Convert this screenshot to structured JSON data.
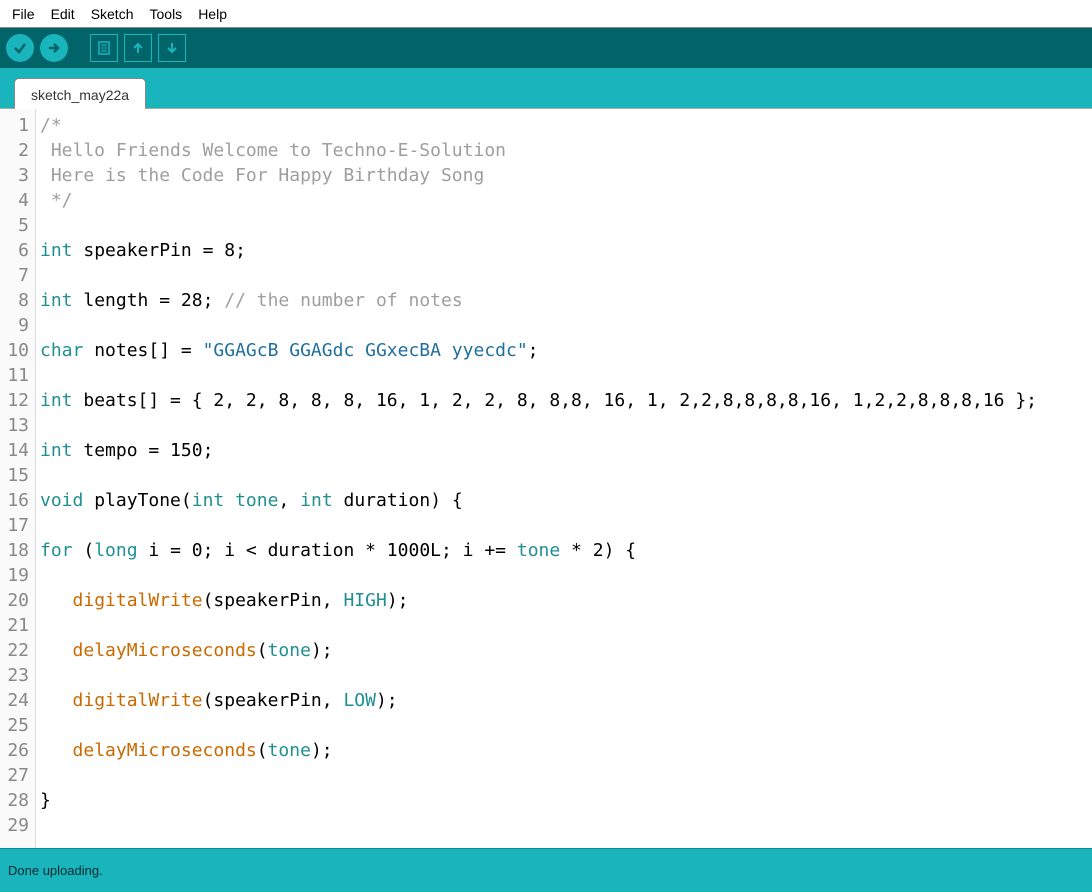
{
  "menu": {
    "items": [
      "File",
      "Edit",
      "Sketch",
      "Tools",
      "Help"
    ]
  },
  "toolbar": {
    "verify": "verify",
    "upload": "upload",
    "new": "new",
    "open": "open",
    "save": "save"
  },
  "tabs": [
    {
      "label": "sketch_may22a"
    }
  ],
  "editor": {
    "lines": [
      [
        {
          "cls": "tok-comment",
          "t": "/*"
        }
      ],
      [
        {
          "cls": "tok-comment",
          "t": " Hello Friends Welcome to Techno-E-Solution"
        }
      ],
      [
        {
          "cls": "tok-comment",
          "t": " Here is the Code For Happy Birthday Song"
        }
      ],
      [
        {
          "cls": "tok-comment",
          "t": " */"
        }
      ],
      [
        {
          "cls": "tok-plain",
          "t": ""
        }
      ],
      [
        {
          "cls": "tok-type",
          "t": "int "
        },
        {
          "cls": "tok-plain",
          "t": "speakerPin = 8;"
        }
      ],
      [
        {
          "cls": "tok-plain",
          "t": ""
        }
      ],
      [
        {
          "cls": "tok-type",
          "t": "int "
        },
        {
          "cls": "tok-plain",
          "t": "length = 28; "
        },
        {
          "cls": "tok-comment",
          "t": "// the number of notes"
        }
      ],
      [
        {
          "cls": "tok-plain",
          "t": ""
        }
      ],
      [
        {
          "cls": "tok-type",
          "t": "char "
        },
        {
          "cls": "tok-plain",
          "t": "notes[] = "
        },
        {
          "cls": "tok-string",
          "t": "\"GGAGcB GGAGdc GGxecBA yyecdc\""
        },
        {
          "cls": "tok-plain",
          "t": ";"
        }
      ],
      [
        {
          "cls": "tok-plain",
          "t": ""
        }
      ],
      [
        {
          "cls": "tok-type",
          "t": "int "
        },
        {
          "cls": "tok-plain",
          "t": "beats[] = { 2, 2, 8, 8, 8, 16, 1, 2, 2, 8, 8,8, 16, 1, 2,2,8,8,8,8,16, 1,2,2,8,8,8,16 };"
        }
      ],
      [
        {
          "cls": "tok-plain",
          "t": ""
        }
      ],
      [
        {
          "cls": "tok-type",
          "t": "int "
        },
        {
          "cls": "tok-plain",
          "t": "tempo = 150;"
        }
      ],
      [
        {
          "cls": "tok-plain",
          "t": ""
        }
      ],
      [
        {
          "cls": "tok-type",
          "t": "void "
        },
        {
          "cls": "tok-plain",
          "t": "playTone("
        },
        {
          "cls": "tok-type",
          "t": "int "
        },
        {
          "cls": "tok-const",
          "t": "tone"
        },
        {
          "cls": "tok-plain",
          "t": ", "
        },
        {
          "cls": "tok-type",
          "t": "int "
        },
        {
          "cls": "tok-plain",
          "t": "duration) {"
        }
      ],
      [
        {
          "cls": "tok-plain",
          "t": ""
        }
      ],
      [
        {
          "cls": "tok-type",
          "t": "for "
        },
        {
          "cls": "tok-plain",
          "t": "("
        },
        {
          "cls": "tok-type",
          "t": "long "
        },
        {
          "cls": "tok-plain",
          "t": "i = 0; i < duration * 1000L; i += "
        },
        {
          "cls": "tok-const",
          "t": "tone"
        },
        {
          "cls": "tok-plain",
          "t": " * 2) {"
        }
      ],
      [
        {
          "cls": "tok-plain",
          "t": ""
        }
      ],
      [
        {
          "cls": "tok-plain",
          "t": "   "
        },
        {
          "cls": "tok-func",
          "t": "digitalWrite"
        },
        {
          "cls": "tok-plain",
          "t": "(speakerPin, "
        },
        {
          "cls": "tok-const",
          "t": "HIGH"
        },
        {
          "cls": "tok-plain",
          "t": ");"
        }
      ],
      [
        {
          "cls": "tok-plain",
          "t": ""
        }
      ],
      [
        {
          "cls": "tok-plain",
          "t": "   "
        },
        {
          "cls": "tok-func",
          "t": "delayMicroseconds"
        },
        {
          "cls": "tok-plain",
          "t": "("
        },
        {
          "cls": "tok-const",
          "t": "tone"
        },
        {
          "cls": "tok-plain",
          "t": ");"
        }
      ],
      [
        {
          "cls": "tok-plain",
          "t": ""
        }
      ],
      [
        {
          "cls": "tok-plain",
          "t": "   "
        },
        {
          "cls": "tok-func",
          "t": "digitalWrite"
        },
        {
          "cls": "tok-plain",
          "t": "(speakerPin, "
        },
        {
          "cls": "tok-const",
          "t": "LOW"
        },
        {
          "cls": "tok-plain",
          "t": ");"
        }
      ],
      [
        {
          "cls": "tok-plain",
          "t": ""
        }
      ],
      [
        {
          "cls": "tok-plain",
          "t": "   "
        },
        {
          "cls": "tok-func",
          "t": "delayMicroseconds"
        },
        {
          "cls": "tok-plain",
          "t": "("
        },
        {
          "cls": "tok-const",
          "t": "tone"
        },
        {
          "cls": "tok-plain",
          "t": ");"
        }
      ],
      [
        {
          "cls": "tok-plain",
          "t": ""
        }
      ],
      [
        {
          "cls": "tok-plain",
          "t": "}"
        }
      ],
      [
        {
          "cls": "tok-plain",
          "t": ""
        }
      ]
    ]
  },
  "status": {
    "message": "Done uploading."
  }
}
